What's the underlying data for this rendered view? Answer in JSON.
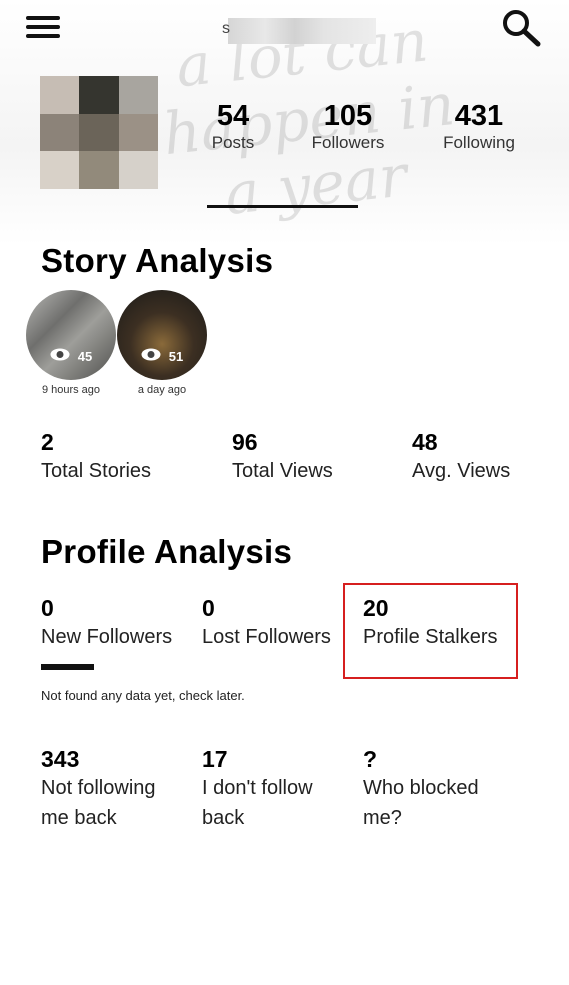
{
  "header": {
    "username_visible": "s",
    "watermark": [
      "a lot can",
      "happen in",
      "a year"
    ]
  },
  "profile": {
    "posts": {
      "value": "54",
      "label": "Posts"
    },
    "followers": {
      "value": "105",
      "label": "Followers"
    },
    "following": {
      "value": "431",
      "label": "Following"
    }
  },
  "story_analysis": {
    "title": "Story Analysis",
    "stories": [
      {
        "views": "45",
        "time": "9 hours ago"
      },
      {
        "views": "51",
        "time": "a day ago"
      }
    ],
    "metrics": [
      {
        "value": "2",
        "label": "Total Stories"
      },
      {
        "value": "96",
        "label": "Total Views"
      },
      {
        "value": "48",
        "label": "Avg. Views"
      }
    ]
  },
  "profile_analysis": {
    "title": "Profile Analysis",
    "metrics": [
      {
        "value": "0",
        "label": "New Followers"
      },
      {
        "value": "0",
        "label": "Lost Followers"
      },
      {
        "value": "20",
        "label": "Profile Stalkers"
      }
    ],
    "note": "Not found any data yet, check later.",
    "more": [
      {
        "value": "343",
        "line1": "Not following",
        "line2": "me back"
      },
      {
        "value": "17",
        "line1": "I don't follow",
        "line2": "back"
      },
      {
        "value": "?",
        "line1": "Who blocked",
        "line2": "me?"
      }
    ]
  },
  "colors": {
    "highlight": "#d61f1f"
  }
}
